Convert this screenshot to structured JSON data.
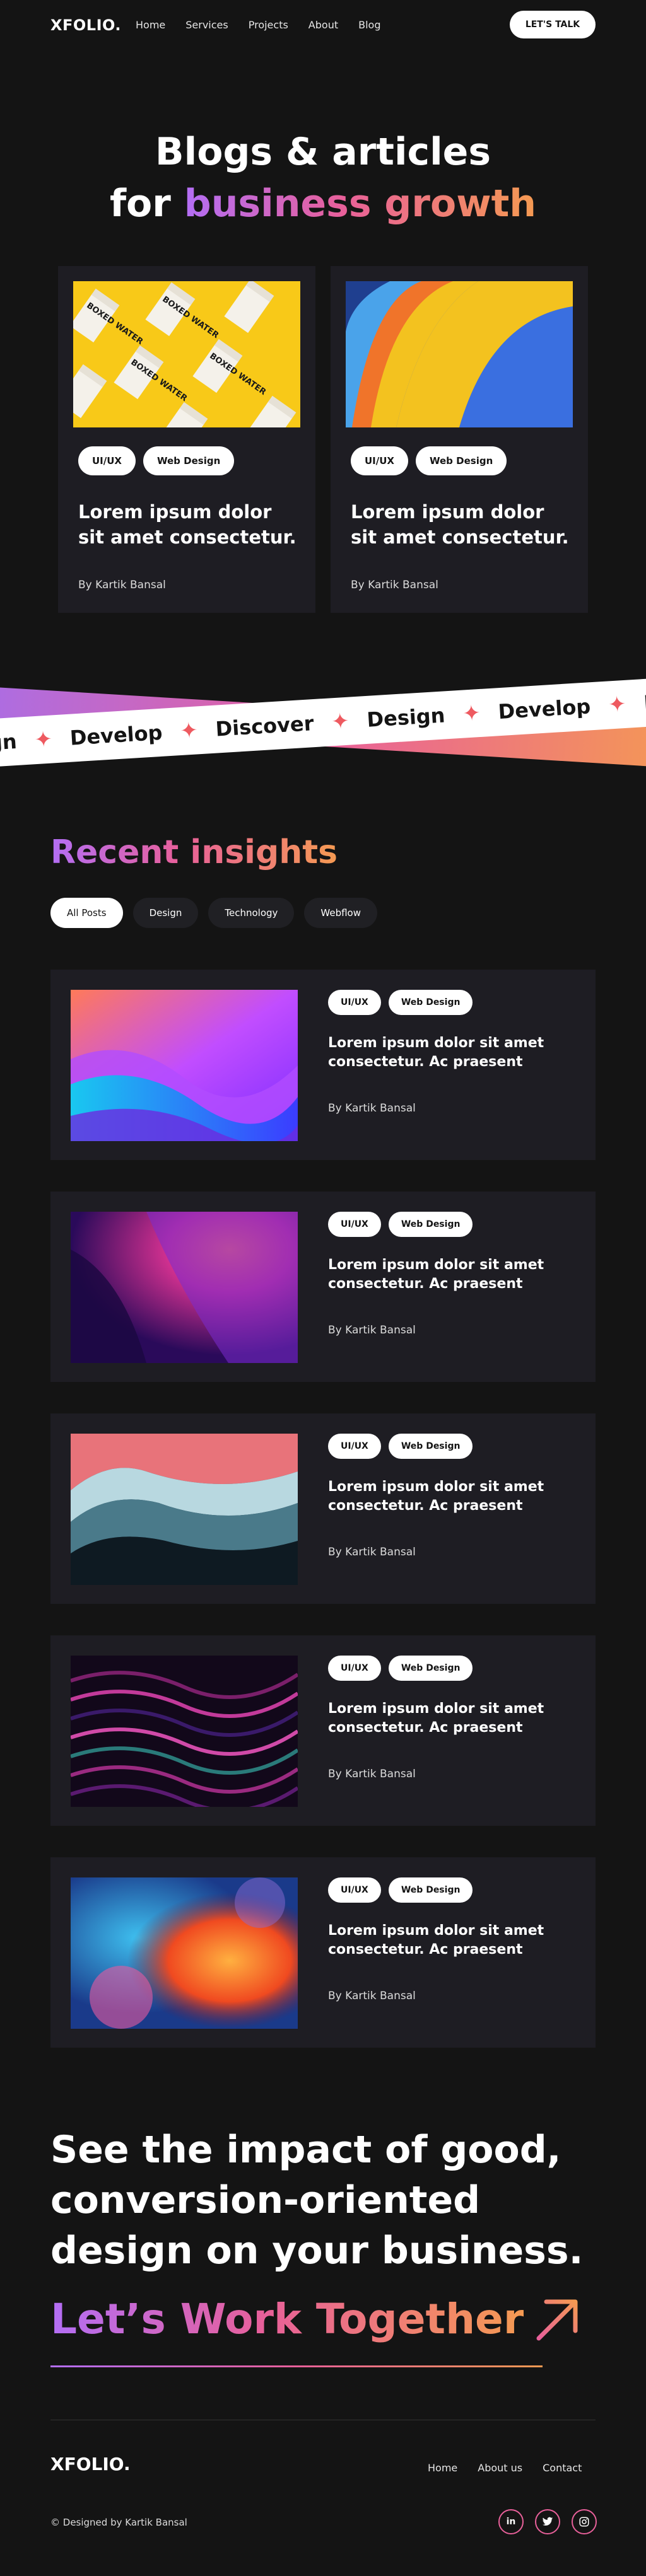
{
  "nav": {
    "logo": "XFOLIO.",
    "links": [
      "Home",
      "Services",
      "Projects",
      "About",
      "Blog"
    ],
    "cta": "LET'S TALK"
  },
  "hero": {
    "line1": "Blogs & articles",
    "line2_plain": "for",
    "line2_gradient": "business growth"
  },
  "featured": [
    {
      "tags": [
        "UI/UX",
        "Web Design"
      ],
      "title": "Lorem ipsum dolor sit amet consectetur.",
      "author": "By Kartik Bansal",
      "image": "boxed-water-on-yellow",
      "box_text": "BOXED WATER"
    },
    {
      "tags": [
        "UI/UX",
        "Web Design"
      ],
      "title": "Lorem ipsum dolor sit amet consectetur.",
      "author": "By Kartik Bansal",
      "image": "color-waves-abstract"
    }
  ],
  "marquee": {
    "items": [
      "gn",
      "Develop",
      "Discover",
      "Design",
      "Develop",
      "Di"
    ],
    "star_icon": "four-point-star-icon"
  },
  "insights": {
    "title": "Recent insights",
    "filters": [
      "All Posts",
      "Design",
      "Technology",
      "Webflow"
    ],
    "active_filter": "All Posts",
    "posts": [
      {
        "tags": [
          "UI/UX",
          "Web Design"
        ],
        "title": "Lorem ipsum dolor sit amet consectetur. Ac praesent",
        "author": "By Kartik Bansal",
        "image": "purple-blue-waves"
      },
      {
        "tags": [
          "UI/UX",
          "Web Design"
        ],
        "title": "Lorem ipsum dolor sit amet consectetur. Ac praesent",
        "author": "By Kartik Bansal",
        "image": "violet-pink-glow"
      },
      {
        "tags": [
          "UI/UX",
          "Web Design"
        ],
        "title": "Lorem ipsum dolor sit amet consectetur. Ac praesent",
        "author": "By Kartik Bansal",
        "image": "red-teal-fluid"
      },
      {
        "tags": [
          "UI/UX",
          "Web Design"
        ],
        "title": "Lorem ipsum dolor sit amet consectetur. Ac praesent",
        "author": "By Kartik Bansal",
        "image": "magenta-fiber-waves"
      },
      {
        "tags": [
          "UI/UX",
          "Web Design"
        ],
        "title": "Lorem ipsum dolor sit amet consectetur. Ac praesent",
        "author": "By Kartik Bansal",
        "image": "blue-orange-smoke"
      }
    ]
  },
  "cta": {
    "text": "See the impact of good, conversion-oriented design on your business.",
    "link": "Let’s Work Together",
    "arrow_icon": "arrow-up-right-icon"
  },
  "footer": {
    "logo": "XFOLIO.",
    "links": [
      "Home",
      "About us",
      "Contact"
    ],
    "copyright": "© Designed by Kartik Bansal",
    "socials": [
      "in",
      "twitter-icon",
      "instagram-icon"
    ]
  },
  "colors": {
    "background": "#141414",
    "card": "#1e1d23",
    "gradient": [
      "#b36ef5",
      "#e8609a",
      "#f59a52"
    ]
  }
}
